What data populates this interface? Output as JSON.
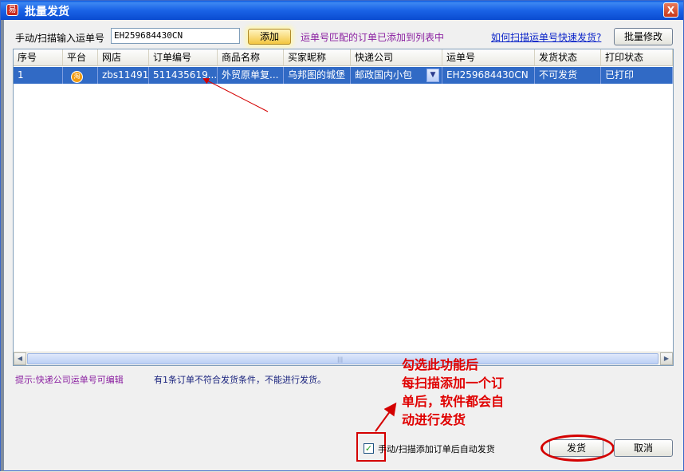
{
  "window": {
    "title": "批量发货",
    "app_icon": "app-icon",
    "close_glyph": "X"
  },
  "toolbar": {
    "scan_label": "手动/扫描输入运单号",
    "scan_value": "EH259684430CN",
    "add_label": "添加",
    "status_message": "运单号匹配的订单已添加到列表中",
    "help_link": "如何扫描运单号快速发货?",
    "batch_edit_label": "批量修改"
  },
  "table": {
    "columns": [
      "序号",
      "平台",
      "网店",
      "订单编号",
      "商品名称",
      "买家昵称",
      "快递公司",
      "运单号",
      "发货状态",
      "打印状态"
    ],
    "rows": [
      {
        "index": "1",
        "platform_icon": "taobao-icon",
        "platform_glyph": "淘",
        "shop": "zbs11491",
        "order_no": "511435619...",
        "product": "外贸原单复...",
        "buyer": "乌邦图的城堡",
        "courier": "邮政国内小包",
        "tracking_no": "EH259684430CN",
        "ship_status": "不可发货",
        "print_status": "已打印"
      }
    ]
  },
  "footer": {
    "tip": "提示:快递公司运单号可编辑",
    "warning": "有1条订单不符合发货条件，不能进行发货。",
    "auto_ship_label": "手动/扫描添加订单后自动发货",
    "auto_ship_checked": true,
    "ship_label": "发货",
    "cancel_label": "取消"
  },
  "annotation": {
    "line1": "勾选此功能后",
    "line2": "每扫描添加一个订",
    "line3": "单后，软件都会自",
    "line4": "动进行发货"
  },
  "colors": {
    "selection": "#316ac5",
    "annotation_red": "#e00000",
    "status_purple": "#8a1fa0",
    "link_blue": "#0a23c8"
  }
}
